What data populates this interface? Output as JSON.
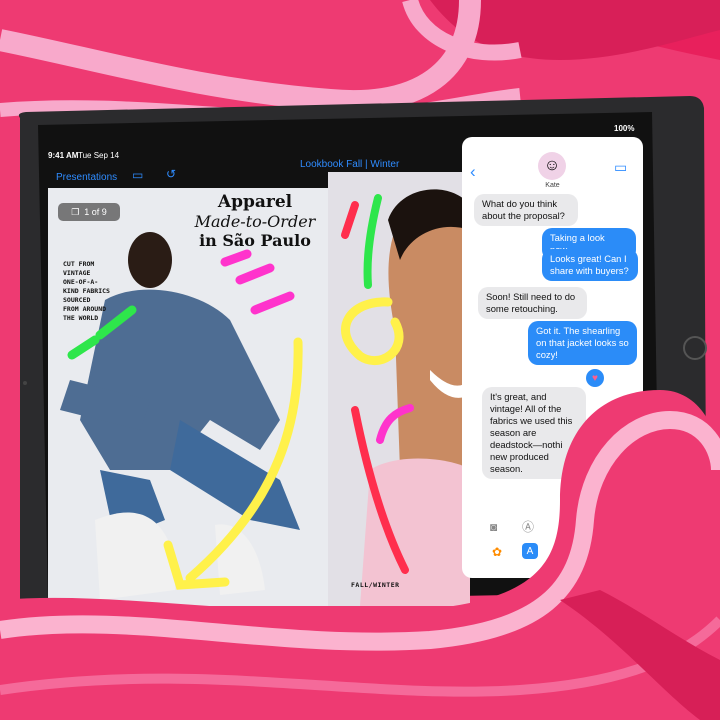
{
  "status_bar": {
    "time": "9:41 AM",
    "date": "Tue Sep 14",
    "battery": "100%"
  },
  "toolbar": {
    "presentations_label": "Presentations",
    "document_title": "Lookbook Fall | Winter"
  },
  "slide": {
    "page_indicator": "1 of 9",
    "title_line1": "Apparel",
    "title_line2": "Made-to-Order",
    "title_line3": "in São Paulo",
    "blurb_lines": [
      "CUT FROM",
      "VINTAGE",
      "ONE-OF-A-",
      "KIND FABRICS",
      "SOURCED",
      "FROM AROUND",
      "THE WORLD"
    ],
    "footer_label": "FALL/WINTER"
  },
  "messages": {
    "contact_name": "Kate",
    "thread": [
      {
        "from": "them",
        "text": "What do you think about the proposal?"
      },
      {
        "from": "me",
        "text": "Taking a look now..."
      },
      {
        "from": "me",
        "text": "Looks great! Can I share with buyers?"
      },
      {
        "from": "them",
        "text": "Soon! Still need to do some retouching."
      },
      {
        "from": "me",
        "text": "Got it. The shearling on that jacket looks so cozy!"
      },
      {
        "from": "them",
        "text": "It's great, and vintage! All of the fabrics we used this season are deadstock—nothi new produced season."
      }
    ]
  },
  "colors": {
    "background_pink": "#ec2f6a",
    "ribbon_light": "#f9a5c8",
    "ribbon_dark": "#d9285c",
    "accent_blue": "#2f8cff",
    "bubble_blue": "#2b8cf8",
    "bubble_gray": "#e9e9eb"
  },
  "icons": [
    "sidebar-icon",
    "undo-icon",
    "back-chevron-icon",
    "video-call-icon",
    "camera-icon",
    "app-store-icon",
    "photos-icon",
    "heart-reaction-icon"
  ]
}
